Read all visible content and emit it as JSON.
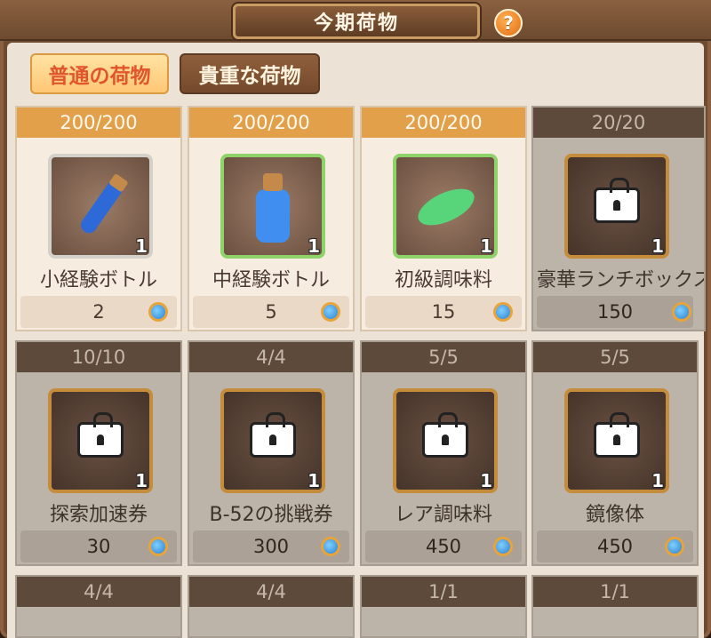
{
  "header": {
    "title": "今期荷物",
    "help_label": "?"
  },
  "tabs": [
    {
      "label": "普通の荷物",
      "active": true
    },
    {
      "label": "貴重な荷物",
      "active": false
    }
  ],
  "items": [
    {
      "stock": "200/200",
      "name": "小経験ボトル",
      "qty": "1",
      "price": "2",
      "locked": false,
      "icon": "blue-vial-icon"
    },
    {
      "stock": "200/200",
      "name": "中経験ボトル",
      "qty": "1",
      "price": "5",
      "locked": false,
      "icon": "blue-bottle-icon"
    },
    {
      "stock": "200/200",
      "name": "初級調味料",
      "qty": "1",
      "price": "15",
      "locked": false,
      "icon": "green-leaf-icon"
    },
    {
      "stock": "20/20",
      "name": "豪華ランチボックス",
      "qty": "1",
      "price": "150",
      "locked": true,
      "icon": "lunch-box-icon"
    },
    {
      "stock": "10/10",
      "name": "探索加速券",
      "qty": "1",
      "price": "30",
      "locked": true,
      "icon": "scroll-icon"
    },
    {
      "stock": "4/4",
      "name": "B-52の挑戦券",
      "qty": "1",
      "price": "300",
      "locked": true,
      "icon": "ticket-icon"
    },
    {
      "stock": "5/5",
      "name": "レア調味料",
      "qty": "1",
      "price": "450",
      "locked": true,
      "icon": "teal-plant-icon"
    },
    {
      "stock": "5/5",
      "name": "鏡像体",
      "qty": "1",
      "price": "450",
      "locked": true,
      "icon": "purple-crystal-icon"
    }
  ],
  "partial_row": [
    {
      "stock": "4/4"
    },
    {
      "stock": "4/4"
    },
    {
      "stock": "1/1"
    },
    {
      "stock": "1/1"
    }
  ],
  "colors": {
    "accent": "#e3a04b",
    "tab_active_text": "#e0552a",
    "locked_cap": "#5e4a3a"
  }
}
